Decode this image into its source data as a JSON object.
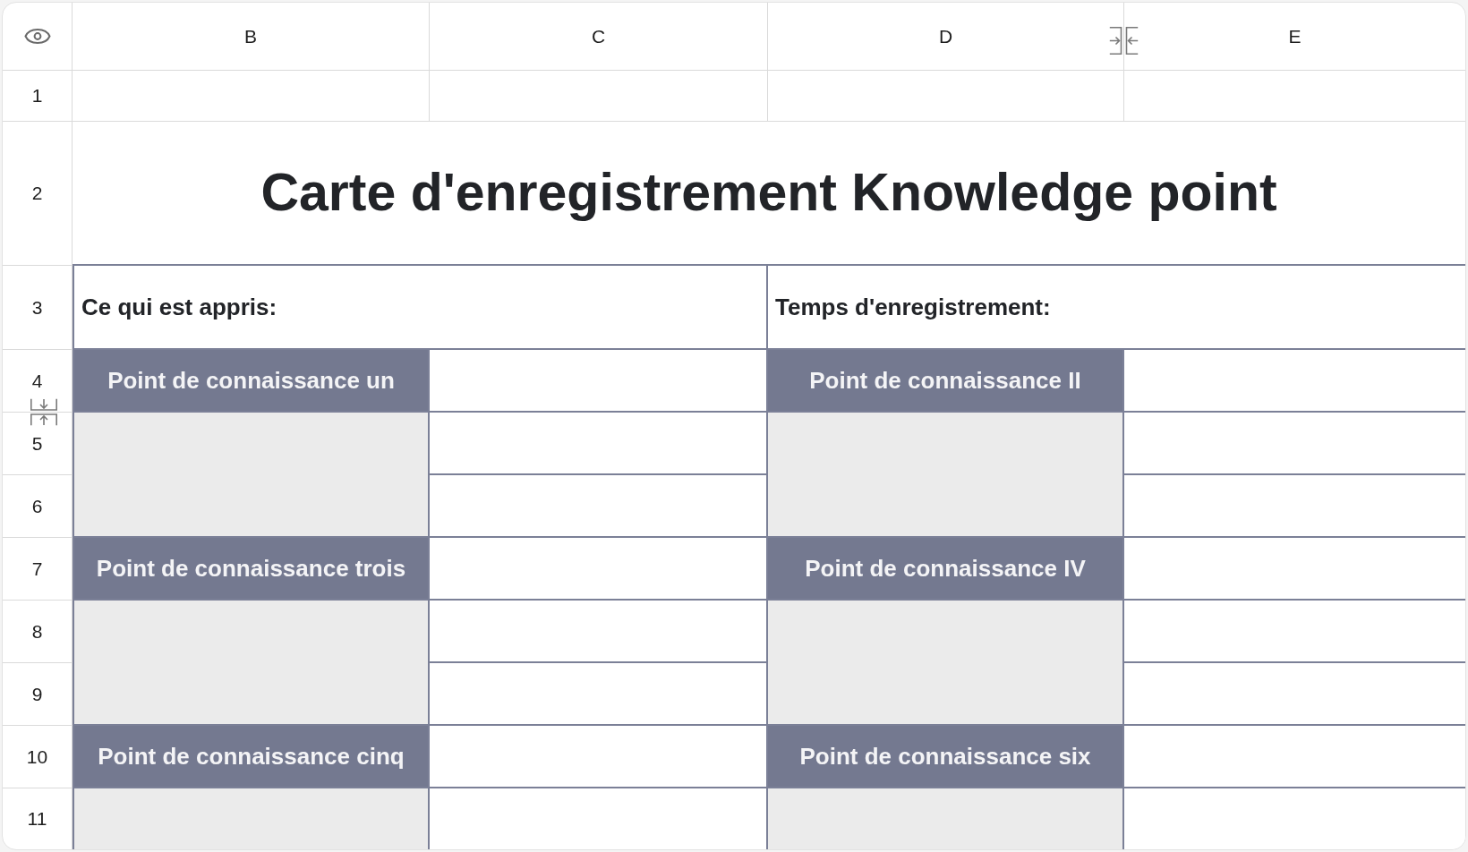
{
  "column_headers": [
    {
      "label": "B",
      "resize_handle": false
    },
    {
      "label": "C",
      "resize_handle": false
    },
    {
      "label": "D",
      "resize_handle": true
    },
    {
      "label": "E",
      "resize_handle": false
    }
  ],
  "row_numbers": [
    {
      "label": "1",
      "resize_handle": false
    },
    {
      "label": "2",
      "resize_handle": false
    },
    {
      "label": "3",
      "resize_handle": false
    },
    {
      "label": "4",
      "resize_handle": true
    },
    {
      "label": "5",
      "resize_handle": false
    },
    {
      "label": "6",
      "resize_handle": false
    },
    {
      "label": "7",
      "resize_handle": false
    },
    {
      "label": "8",
      "resize_handle": false
    },
    {
      "label": "9",
      "resize_handle": false
    },
    {
      "label": "10",
      "resize_handle": false
    },
    {
      "label": "11",
      "resize_handle": false
    }
  ],
  "title": "Carte d'enregistrement Knowledge point",
  "section_labels": [
    "Ce qui est appris:",
    "Temps d'enregistrement:"
  ],
  "knowledge_points": [
    "Point de connaissance un",
    "Point de connaissance II",
    "Point de connaissance trois",
    "Point de connaissance IV",
    "Point de connaissance cinq",
    "Point de connaissance six"
  ]
}
